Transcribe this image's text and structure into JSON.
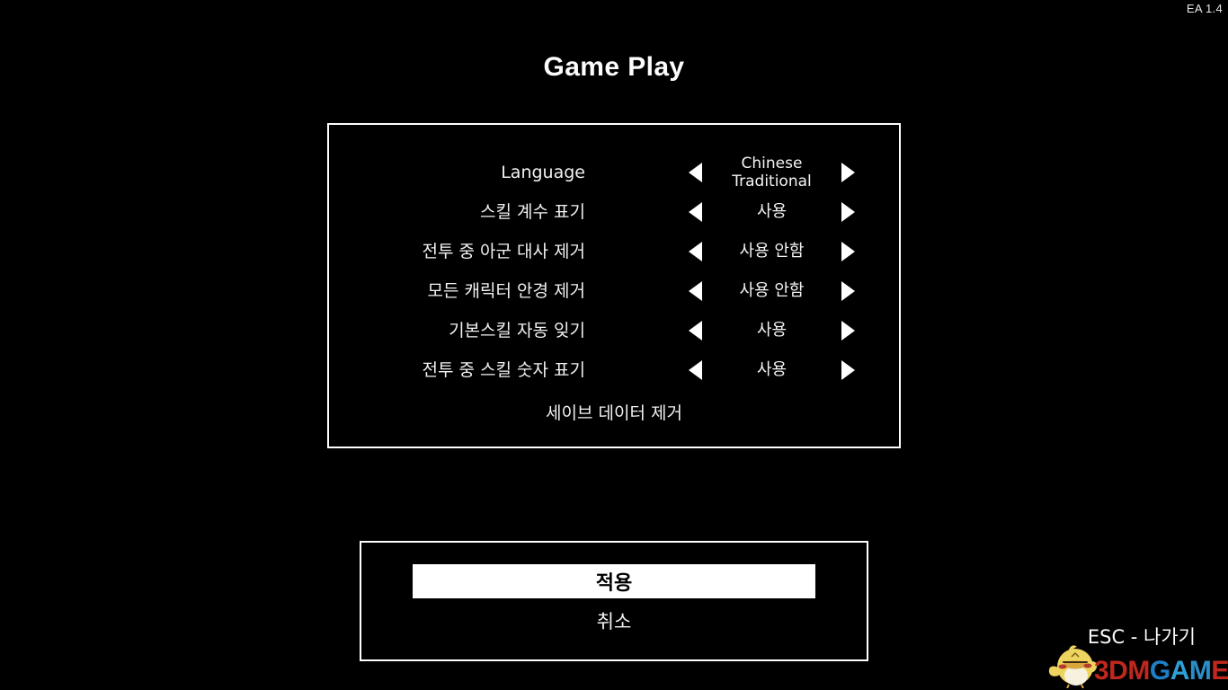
{
  "version_tag": "EA 1.4",
  "page_title": "Game Play",
  "settings": {
    "options": [
      {
        "label": "Language",
        "value": "Chinese Traditional",
        "left_arrow": "arrow-left-icon",
        "right_arrow": "arrow-right-icon",
        "two_line": true
      },
      {
        "label": "스킬 계수 표기",
        "value": "사용",
        "left_arrow": "arrow-left-icon",
        "right_arrow": "arrow-right-icon",
        "two_line": false
      },
      {
        "label": "전투 중 아군 대사 제거",
        "value": "사용 안함",
        "left_arrow": "arrow-left-icon",
        "right_arrow": "arrow-right-icon",
        "two_line": false
      },
      {
        "label": "모든 캐릭터 안경 제거",
        "value": "사용 안함",
        "left_arrow": "arrow-left-icon",
        "right_arrow": "arrow-right-icon",
        "two_line": false
      },
      {
        "label": "기본스킬 자동 잊기",
        "value": "사용",
        "left_arrow": "arrow-left-icon",
        "right_arrow": "arrow-right-icon",
        "two_line": false
      },
      {
        "label": "전투 중 스킬 숫자 표기",
        "value": "사용",
        "left_arrow": "arrow-left-icon",
        "right_arrow": "arrow-right-icon",
        "two_line": false
      }
    ],
    "action_row": {
      "label": "세이브 데이터 제거"
    }
  },
  "buttons": {
    "apply": "적용",
    "cancel": "취소"
  },
  "esc_hint": "ESC - 나가기",
  "watermark": {
    "part1": "3DM",
    "part2": "G",
    "part3": "A",
    "part4": "M",
    "part5": "E",
    "mascot": "bird-mascot-icon"
  },
  "colors": {
    "background": "#000000",
    "text": "#ffffff",
    "panel_border": "#ffffff",
    "apply_button_bg": "#ffffff",
    "apply_button_text": "#000000",
    "watermark_red": "#c0281e",
    "watermark_blue": "#1f7fc4",
    "mascot_body": "#e8cf5c",
    "mascot_cheek": "#b73a2e"
  }
}
